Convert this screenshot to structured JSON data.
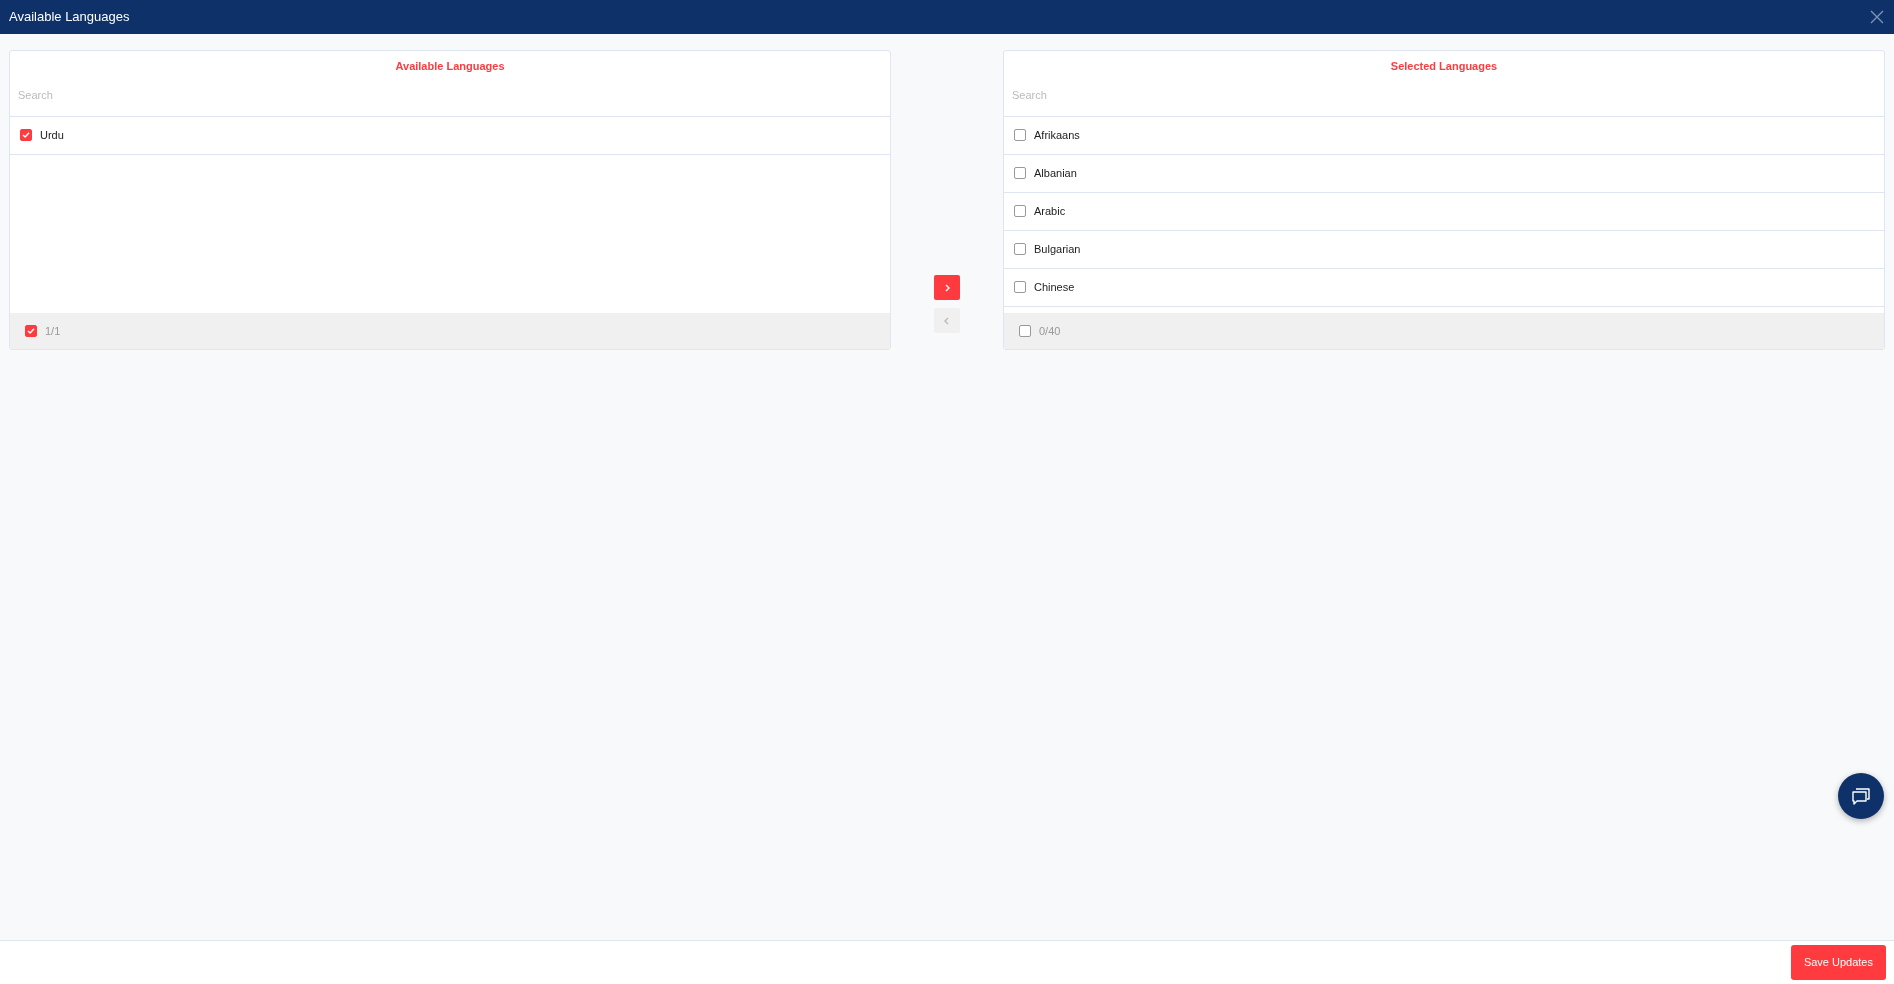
{
  "window": {
    "title": "Available Languages"
  },
  "panels": [
    {
      "title": "Available Languages",
      "search": {
        "placeholder": "Search"
      },
      "items": [
        {
          "label": "Urdu",
          "checked": true
        }
      ],
      "footer": {
        "count": "1/1",
        "checked": true
      }
    },
    {
      "title": "Selected Languages",
      "search": {
        "placeholder": "Search"
      },
      "items": [
        {
          "label": "Afrikaans",
          "checked": false
        },
        {
          "label": "Albanian",
          "checked": false
        },
        {
          "label": "Arabic",
          "checked": false
        },
        {
          "label": "Bulgarian",
          "checked": false
        },
        {
          "label": "Chinese",
          "checked": false
        }
      ],
      "footer": {
        "count": "0/40",
        "checked": false
      }
    }
  ],
  "transfer": [
    {
      "kind": "right",
      "disabled": false
    },
    {
      "kind": "left",
      "disabled": true
    }
  ],
  "save_button": "Save Updates"
}
